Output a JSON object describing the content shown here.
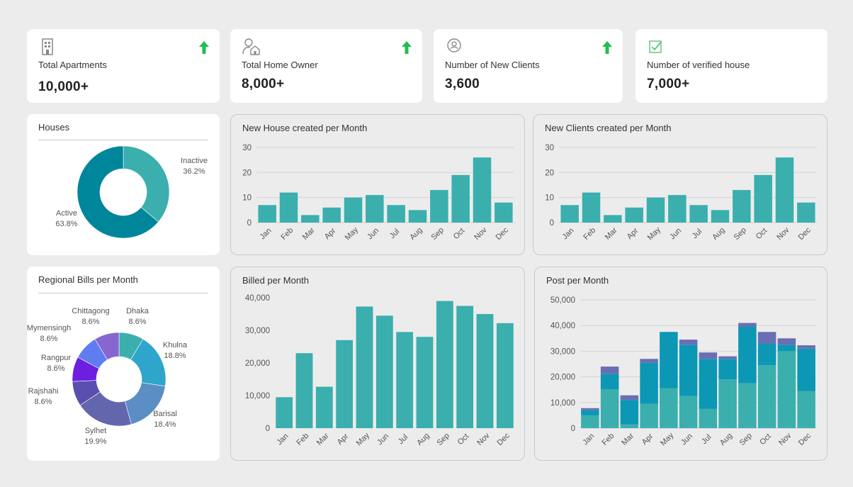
{
  "colors": {
    "bar": "#3aafae",
    "up_arrow": "#1fbf4f",
    "stack_bottom": "#3aafae",
    "stack_middle": "#0c97b5",
    "stack_top": "#6a6fb3"
  },
  "stats": [
    {
      "label": "Total Apartments",
      "value": "10,000+",
      "icon": "building-icon",
      "trend": "up"
    },
    {
      "label": "Total Home Owner",
      "value": "8,000+",
      "icon": "home-owner-icon",
      "trend": "up"
    },
    {
      "label": "Number of New Clients",
      "value": "3,600",
      "icon": "client-badge-icon",
      "trend": "up"
    },
    {
      "label": "Number of verified house",
      "value": "7,000+",
      "icon": "verified-check-icon",
      "trend": "none"
    }
  ],
  "houses": {
    "title": "Houses"
  },
  "regional": {
    "title": "Regional Bills per Month"
  },
  "charts": {
    "new_house": {
      "title": "New House created per Month"
    },
    "new_clients": {
      "title": "New Clients created per Month"
    },
    "billed": {
      "title": "Billed per Month"
    },
    "post": {
      "title": "Post per Month"
    }
  },
  "chart_data": [
    {
      "id": "houses",
      "type": "pie",
      "donut": true,
      "slices": [
        {
          "label": "Inactive",
          "pct_label": "36.2%",
          "value": 36.2,
          "color": "#3aafae"
        },
        {
          "label": "Active",
          "pct_label": "63.8%",
          "value": 63.8,
          "color": "#00869a"
        }
      ]
    },
    {
      "id": "regional",
      "type": "pie",
      "donut": true,
      "slices": [
        {
          "label": "Dhaka",
          "pct_label": "8.6%",
          "value": 8.6,
          "color": "#3aafae"
        },
        {
          "label": "Khulna",
          "pct_label": "18.8%",
          "value": 18.8,
          "color": "#2ea6cc"
        },
        {
          "label": "Barisal",
          "pct_label": "18.4%",
          "value": 18.4,
          "color": "#5b8ec5"
        },
        {
          "label": "Sylhet",
          "pct_label": "19.9%",
          "value": 19.9,
          "color": "#6466ad"
        },
        {
          "label": "Rajshahi",
          "pct_label": "8.6%",
          "value": 8.6,
          "color": "#5a4fb0"
        },
        {
          "label": "Rangpur",
          "pct_label": "8.6%",
          "value": 8.6,
          "color": "#6d1fe0"
        },
        {
          "label": "Mymensingh",
          "pct_label": "8.6%",
          "value": 8.6,
          "color": "#5f7df0"
        },
        {
          "label": "Chittagong",
          "pct_label": "8.6%",
          "value": 8.6,
          "color": "#8866d2"
        }
      ]
    },
    {
      "id": "new_house",
      "type": "bar",
      "categories": [
        "Jan",
        "Feb",
        "Mar",
        "Apr",
        "May",
        "Jun",
        "Jul",
        "Aug",
        "Sep",
        "Oct",
        "Nov",
        "Dec"
      ],
      "values": [
        7,
        12,
        3,
        6,
        10,
        11,
        7,
        5,
        13,
        19,
        26,
        8
      ],
      "ylim": [
        0,
        30
      ],
      "yticks": [
        0,
        10,
        20,
        30
      ],
      "ytick_labels": [
        "0",
        "10",
        "20",
        "30"
      ],
      "grid": true
    },
    {
      "id": "new_clients",
      "type": "bar",
      "categories": [
        "Jan",
        "Feb",
        "Mar",
        "Apr",
        "May",
        "Jun",
        "Jul",
        "Aug",
        "Sep",
        "Oct",
        "Nov",
        "Dec"
      ],
      "values": [
        7,
        12,
        3,
        6,
        10,
        11,
        7,
        5,
        13,
        19,
        26,
        8
      ],
      "ylim": [
        0,
        30
      ],
      "yticks": [
        0,
        10,
        20,
        30
      ],
      "ytick_labels": [
        "0",
        "10",
        "20",
        "30"
      ],
      "grid": true
    },
    {
      "id": "billed",
      "type": "bar",
      "categories": [
        "Jan",
        "Feb",
        "Mar",
        "Apr",
        "May",
        "Jun",
        "Jul",
        "Aug",
        "Sep",
        "Oct",
        "Nov",
        "Dec"
      ],
      "values": [
        9500,
        23000,
        12700,
        27000,
        37300,
        34500,
        29500,
        28000,
        39000,
        37500,
        35000,
        32200
      ],
      "ylim": [
        0,
        40000
      ],
      "yticks": [
        0,
        10000,
        20000,
        30000,
        40000
      ],
      "ytick_labels": [
        "0",
        "10,000",
        "20,000",
        "30,000",
        "40,000"
      ],
      "grid": false
    },
    {
      "id": "post",
      "type": "bar",
      "stacked": true,
      "categories": [
        "Jan",
        "Feb",
        "Mar",
        "Apr",
        "May",
        "Jun",
        "Jul",
        "Aug",
        "Sep",
        "Oct",
        "Nov",
        "Dec"
      ],
      "series": [
        {
          "values": [
            5000,
            15200,
            1500,
            9500,
            15500,
            12500,
            7500,
            19000,
            17500,
            24500,
            30000,
            14500
          ]
        },
        {
          "values": [
            2000,
            6000,
            9500,
            16000,
            22000,
            20000,
            19500,
            8000,
            22000,
            8500,
            2500,
            16500
          ]
        },
        {
          "values": [
            800,
            2800,
            1800,
            1500,
            0,
            2000,
            2500,
            1000,
            1500,
            4500,
            2500,
            1300
          ]
        }
      ],
      "ylim": [
        0,
        50000
      ],
      "yticks": [
        0,
        10000,
        20000,
        30000,
        40000,
        50000
      ],
      "ytick_labels": [
        "0",
        "10,000",
        "20,000",
        "30,000",
        "40,000",
        "50,000"
      ],
      "grid": true
    }
  ]
}
